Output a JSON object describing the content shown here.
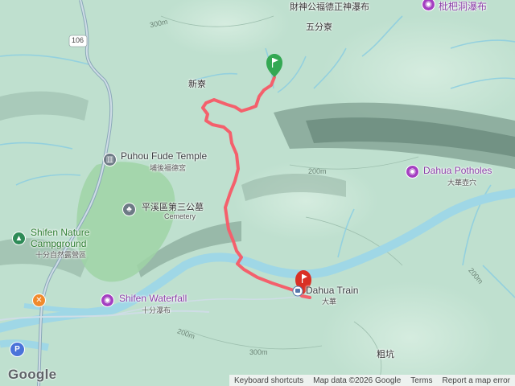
{
  "places": {
    "temple_top": "財神公福德正神瀑布",
    "wufenliao": "五分寮",
    "xinliao": "新寮",
    "puhou_en": "Puhou Fude Temple",
    "puhou_zh": "埔後福德宮",
    "dahua_potholes_en": "Dahua Potholes",
    "dahua_potholes_zh": "大華壺穴",
    "cemetery_zh": "平溪區第三公墓",
    "cemetery_en": "Cemetery",
    "shifen_camp_en_1": "Shifen Nature",
    "shifen_camp_en_2": "Campground",
    "shifen_camp_zh": "十分自然露營區",
    "shifen_falls_en": "Shifen Waterfall",
    "shifen_falls_zh": "十分瀑布",
    "dahua_train_en": "Dahua Train",
    "dahua_zh": "大華",
    "cukeng": "粗坑",
    "pipa_falls": "枇杷洞瀑布",
    "route_number": "106"
  },
  "contours": {
    "c1": "300m",
    "c2": "200m",
    "c3": "200m",
    "c4": "200m",
    "c5": "300m"
  },
  "footer": {
    "logo": "Google",
    "keyboard": "Keyboard shortcuts",
    "map_data": "Map data ©2026 Google",
    "terms": "Terms",
    "report": "Report a map error"
  },
  "icons": {
    "start": "green-flag-icon",
    "end": "red-marker-icon",
    "temple": "temple-icon",
    "scenic": "camera-icon",
    "tent": "tent-icon",
    "restaurant": "fork-knife-icon",
    "parking": "parking-icon",
    "cemetery": "tree-icon",
    "train": "train-icon"
  },
  "colors": {
    "route": "#f4606c",
    "river": "#9fd7e6",
    "land": "#bfe0cf",
    "park": "#9fd4a6",
    "poi_purple": "#a43fc1",
    "poi_gray": "#6d7a85",
    "poi_green": "#2e8b57",
    "poi_orange": "#f08a2c",
    "poi_blue": "#4a73d9",
    "start_flag": "#34a853",
    "end_marker": "#d93025"
  }
}
